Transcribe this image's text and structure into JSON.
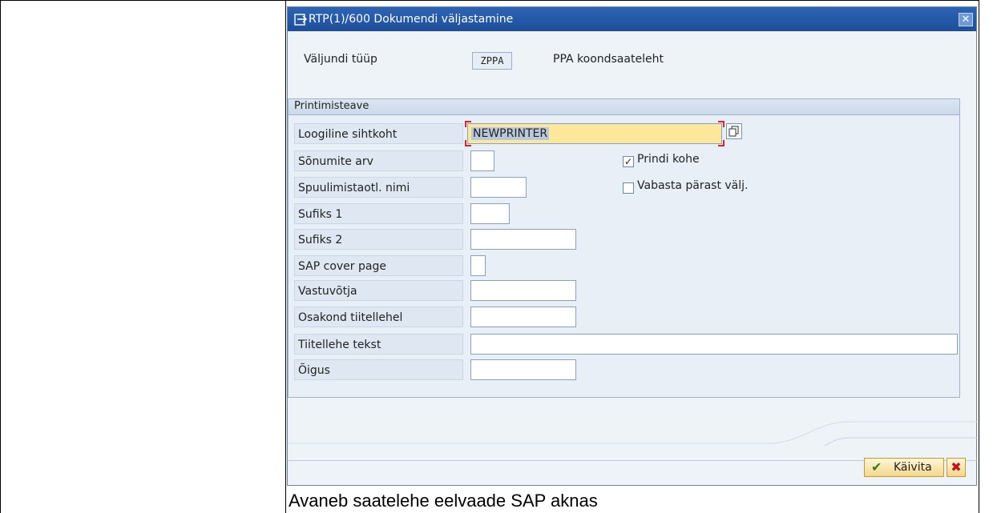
{
  "dialog": {
    "title": "RTP(1)/600 Dokumendi väljastamine",
    "output_type_label": "Väljundi tüüp",
    "output_type_value": "ZPPA",
    "output_type_desc": "PPA koondsaateleht"
  },
  "group": {
    "title": "Printimisteave",
    "fields": [
      {
        "label": "Loogiline sihtkoht",
        "value": "NEWPRINTER"
      },
      {
        "label": "Sõnumite arv",
        "value": ""
      },
      {
        "label": "Spuulimistaotl. nimi",
        "value": ""
      },
      {
        "label": "Sufiks 1",
        "value": ""
      },
      {
        "label": "Sufiks 2",
        "value": ""
      },
      {
        "label": "SAP cover page",
        "value": ""
      },
      {
        "label": "Vastuvõtja",
        "value": ""
      },
      {
        "label": "Osakond tiitellehel",
        "value": ""
      },
      {
        "label": "Tiitellehe tekst",
        "value": ""
      },
      {
        "label": "Õigus",
        "value": ""
      }
    ],
    "checkboxes": [
      {
        "label": "Prindi kohe",
        "checked": true
      },
      {
        "label": "Vabasta pärast välj.",
        "checked": false
      }
    ]
  },
  "buttons": {
    "execute_label": "Käivita",
    "close_symbol": "✕",
    "cancel_symbol": "✖"
  },
  "caption": "Avaneb saatelehe eelvaade SAP aknas",
  "colors": {
    "titlebar": "#2d64b4",
    "active_field": "#fce79a",
    "dialog_bg": "#eef3f8"
  }
}
